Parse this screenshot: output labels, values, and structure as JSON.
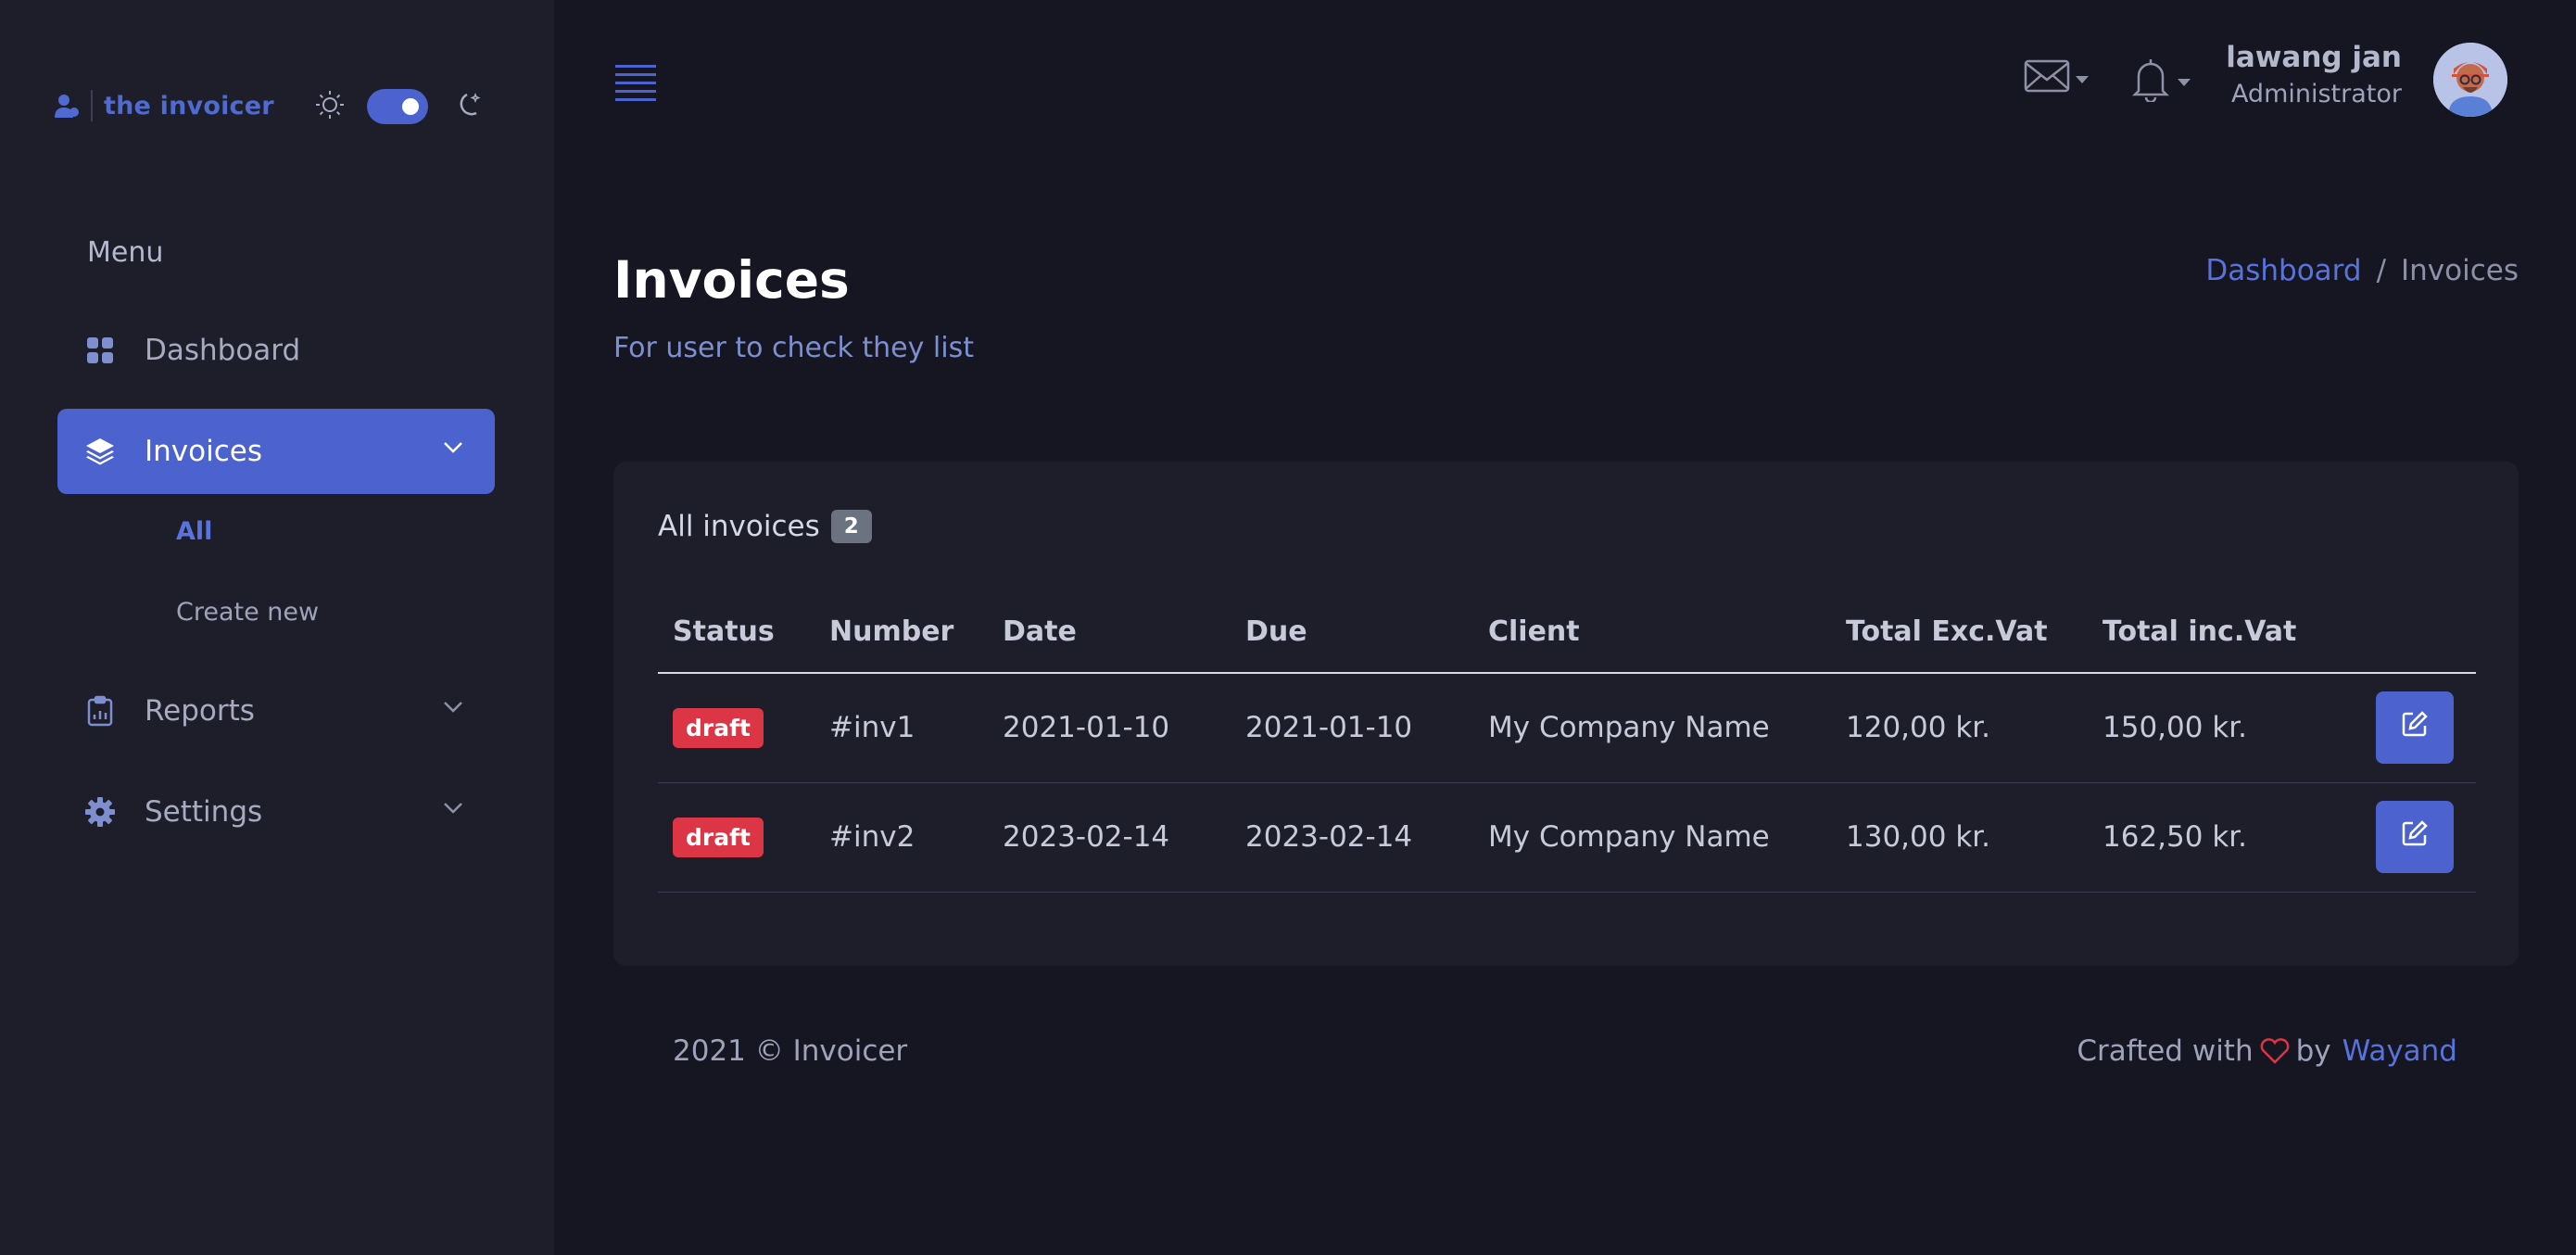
{
  "brand": {
    "name": "the invoicer"
  },
  "sidebar": {
    "menu_title": "Menu",
    "items": [
      {
        "label": "Dashboard",
        "icon": "grid-icon",
        "active": false
      },
      {
        "label": "Invoices",
        "icon": "layers-icon",
        "active": true
      },
      {
        "label": "Reports",
        "icon": "clipboard-chart-icon",
        "active": false
      },
      {
        "label": "Settings",
        "icon": "gear-icon",
        "active": false
      }
    ],
    "invoices_sub": [
      {
        "label": "All",
        "active": true
      },
      {
        "label": "Create new",
        "active": false
      }
    ]
  },
  "header": {
    "user_name": "lawang jan",
    "user_role": "Administrator"
  },
  "page": {
    "title": "Invoices",
    "subtitle": "For user to check they list",
    "breadcrumb": {
      "home": "Dashboard",
      "separator": "/",
      "current": "Invoices"
    }
  },
  "card": {
    "title": "All invoices",
    "count": "2",
    "columns": [
      "Status",
      "Number",
      "Date",
      "Due",
      "Client",
      "Total Exc.Vat",
      "Total inc.Vat"
    ],
    "rows": [
      {
        "status": "draft",
        "number": "#inv1",
        "date": "2021-01-10",
        "due": "2021-01-10",
        "client": "My Company Name",
        "total_exc": "120,00 kr.",
        "total_inc": "150,00 kr."
      },
      {
        "status": "draft",
        "number": "#inv2",
        "date": "2023-02-14",
        "due": "2023-02-14",
        "client": "My Company Name",
        "total_exc": "130,00 kr.",
        "total_inc": "162,50 kr."
      }
    ]
  },
  "footer": {
    "copyright": "2021 © Invoicer",
    "crafted_prefix": "Crafted with",
    "crafted_by": "by",
    "author": "Wayand"
  },
  "colors": {
    "accent": "#4b62cf",
    "background": "#161622",
    "panel": "#1e1e2b",
    "danger": "#dc3545"
  }
}
